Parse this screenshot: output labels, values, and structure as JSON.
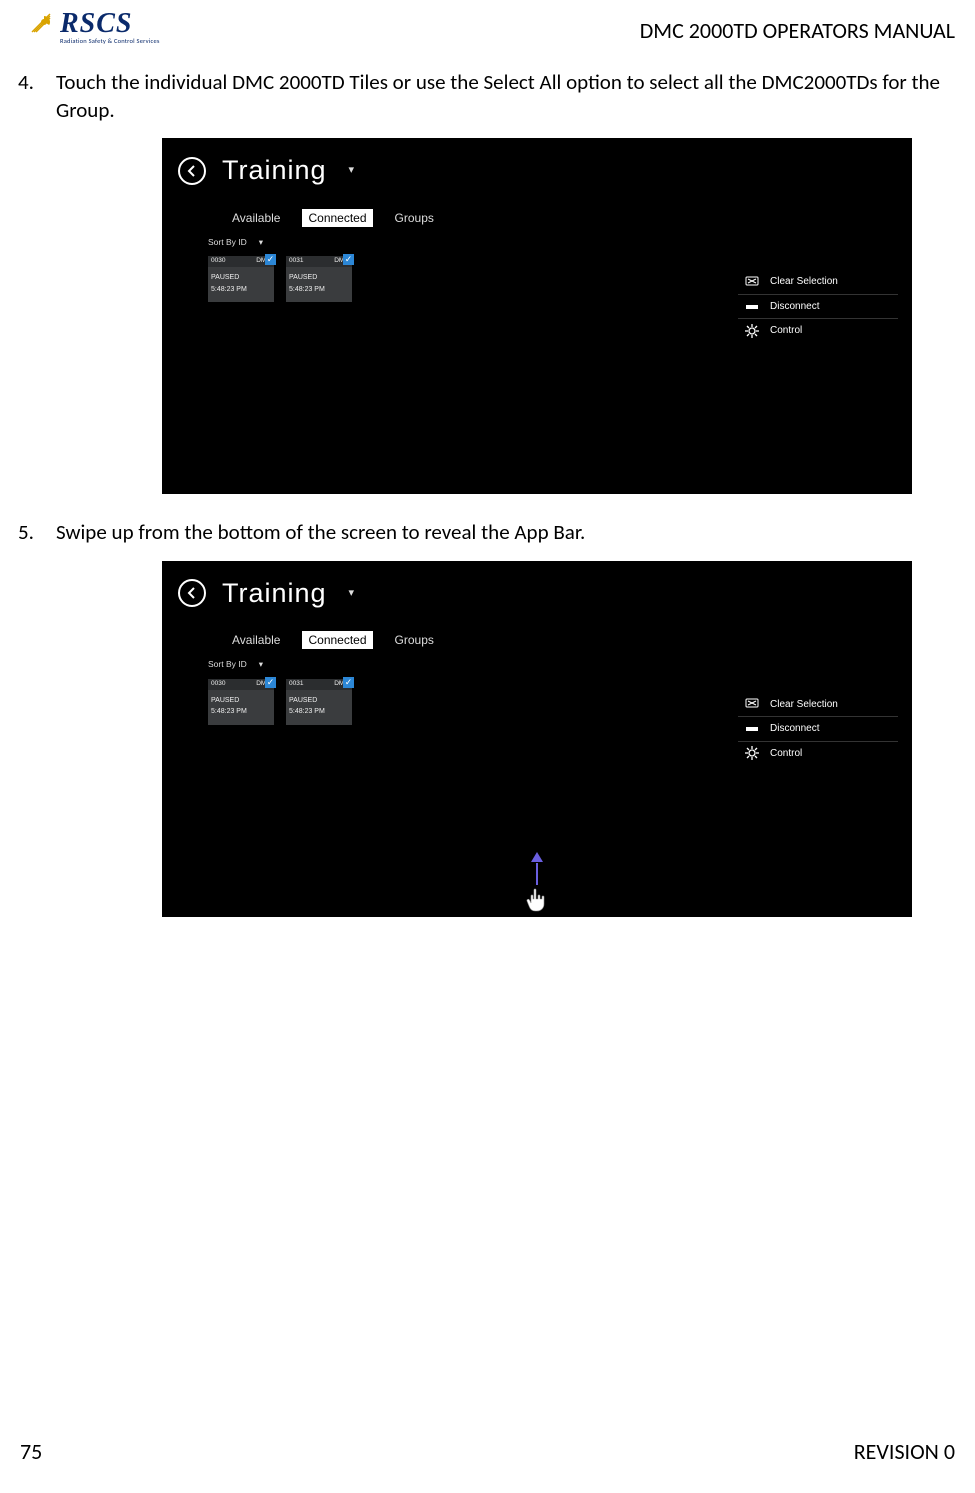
{
  "header": {
    "logo_main": "RSCS",
    "logo_sub": "Radiation Safety & Control Services",
    "doc_title": "DMC 2000TD OPERATORS MANUAL"
  },
  "steps": [
    {
      "text": "Touch the individual DMC 2000TD Tiles or use the Select All option to select all the DMC2000TDs for the Group."
    },
    {
      "text": "Swipe up from the bottom of the screen to reveal the App Bar."
    }
  ],
  "screenshot": {
    "title": "Training",
    "tabs": {
      "available": "Available",
      "connected": "Connected",
      "groups": "Groups"
    },
    "sort_label": "Sort By ID",
    "tiles": [
      {
        "id": "0030",
        "type": "DMC",
        "status": "PAUSED",
        "time": "5:48:23 PM"
      },
      {
        "id": "0031",
        "type": "DMC",
        "status": "PAUSED",
        "time": "5:48:23 PM"
      }
    ],
    "side_menu": {
      "clear": "Clear Selection",
      "disconnect": "Disconnect",
      "control": "Control"
    }
  },
  "footer": {
    "page_num": "75",
    "revision": "REVISION 0"
  }
}
